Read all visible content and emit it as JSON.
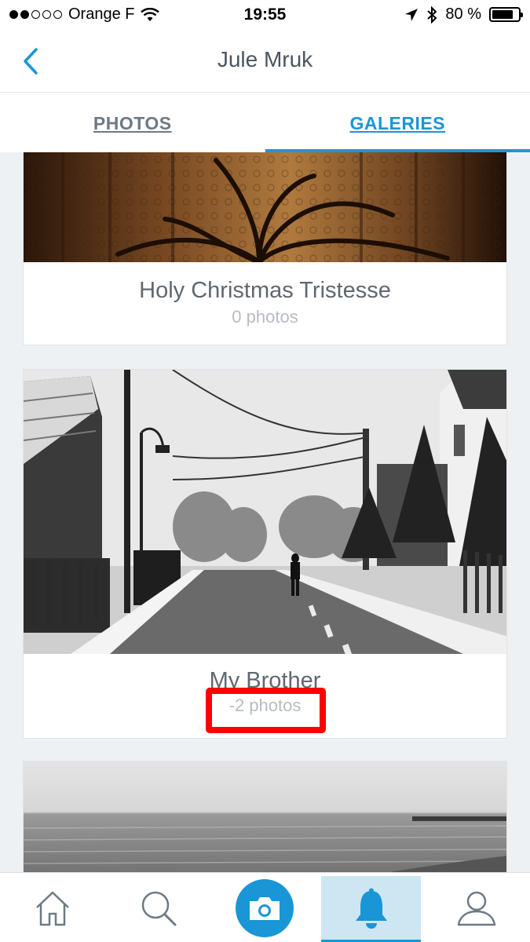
{
  "status_bar": {
    "carrier": "Orange F",
    "time": "19:55",
    "battery": "80 %",
    "battery_level": 0.8,
    "signal_bars": 2
  },
  "nav": {
    "title": "Jule Mruk",
    "back_icon": "chevron-left-icon"
  },
  "tabs": [
    {
      "label": "PHOTOS",
      "active": false
    },
    {
      "label": "GALERIES",
      "active": true
    }
  ],
  "galleries": [
    {
      "title": "Holy Christmas Tristesse",
      "count": "0 photos"
    },
    {
      "title": "My Brother",
      "count": "-2 photos"
    }
  ],
  "tab_bar": {
    "items": [
      "home-icon",
      "search-icon",
      "camera-icon",
      "bell-icon",
      "profile-icon"
    ],
    "active": "bell-icon"
  },
  "colors": {
    "accent": "#1a96d6",
    "highlight": "#ff0000",
    "active_tab_bg": "#cde6f2"
  }
}
